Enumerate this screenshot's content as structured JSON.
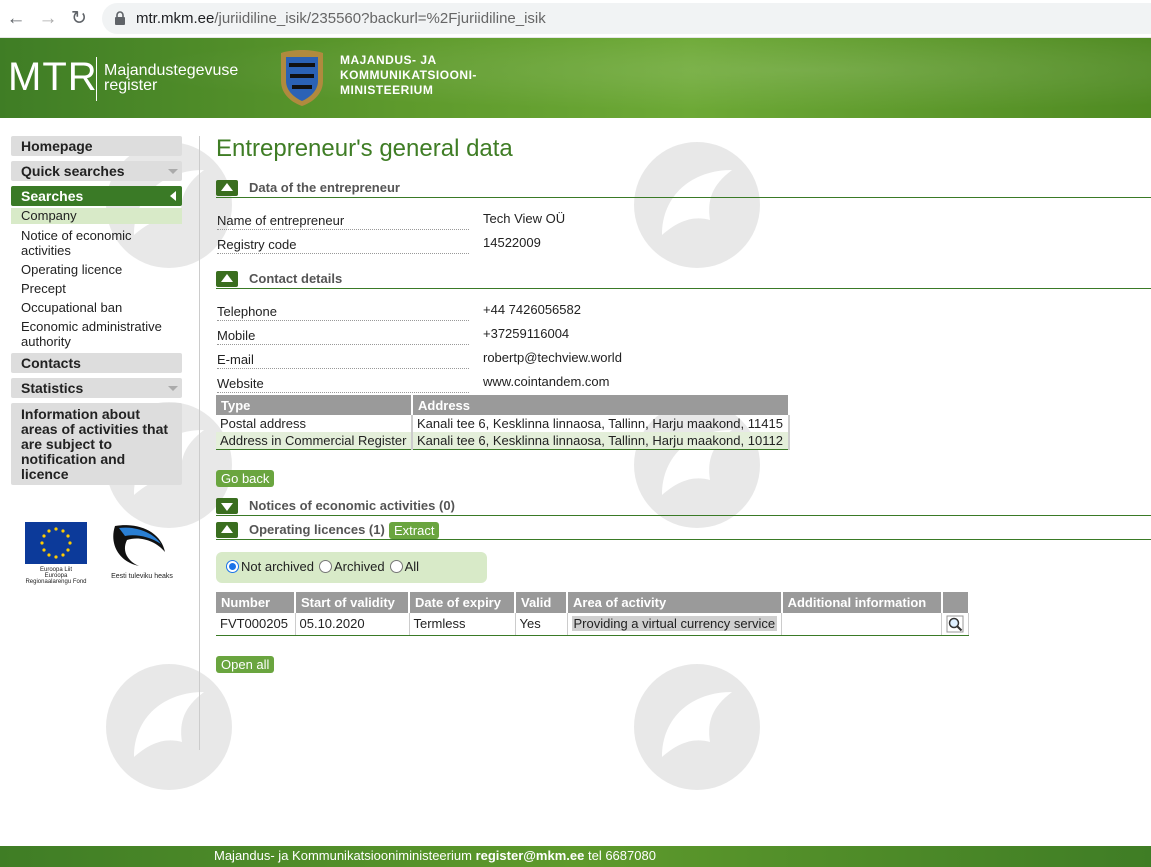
{
  "browser": {
    "url_host": "mtr.mkm.ee",
    "url_path": "/juriidiline_isik/235560?backurl=%2Fjuriidiline_isik"
  },
  "header": {
    "logo": "MTR",
    "logo_sub_line1": "Majandustegevuse",
    "logo_sub_line2": "register",
    "ministry_line1": "MAJANDUS- JA",
    "ministry_line2": "KOMMUNIKATSIOONI-",
    "ministry_line3": "MINISTEERIUM"
  },
  "sidebar": {
    "homepage": "Homepage",
    "quick_searches": "Quick searches",
    "searches": "Searches",
    "search_items": [
      "Company",
      "Notice of economic activities",
      "Operating licence",
      "Precept",
      "Occupational ban",
      "Economic administrative authority"
    ],
    "contacts": "Contacts",
    "statistics": "Statistics",
    "info": "Information about areas of activities that are subject to notification and licence",
    "eu_caption_1": "Euroopa Liit",
    "eu_caption_2": "Euroopa",
    "eu_caption_3": "Regionaalarengu Fond",
    "est_caption": "Eesti tuleviku heaks"
  },
  "main": {
    "title": "Entrepreneur's general data",
    "section_entrepreneur": "Data of the entrepreneur",
    "name_label": "Name of entrepreneur",
    "name_value": "Tech View OÜ",
    "reg_label": "Registry code",
    "reg_value": "14522009",
    "section_contact": "Contact details",
    "phone_label": "Telephone",
    "phone_value": "+44 7426056582",
    "mobile_label": "Mobile",
    "mobile_value": "+37259116004",
    "email_label": "E-mail",
    "email_value": "robertp@techview.world",
    "website_label": "Website",
    "website_value": "www.cointandem.com",
    "address_headers": [
      "Type",
      "Address"
    ],
    "addresses": [
      [
        "Postal address",
        "Kanali tee 6, Kesklinna linnaosa, Tallinn, Harju maakond, 11415"
      ],
      [
        "Address in Commercial Register",
        "Kanali tee 6, Kesklinna linnaosa, Tallinn, Harju maakond, 10112"
      ]
    ],
    "go_back": "Go back",
    "section_notices": "Notices of economic activities (0)",
    "section_licences": "Operating licences (1)",
    "extract": "Extract",
    "radio_not_archived": "Not archived",
    "radio_archived": "Archived",
    "radio_all": "All",
    "licence_headers": [
      "Number",
      "Start of validity",
      "Date of expiry",
      "Valid",
      "Area of activity",
      "Additional information"
    ],
    "licences": [
      [
        "FVT000205",
        "05.10.2020",
        "Termless",
        "Yes",
        "Providing a virtual currency service",
        ""
      ]
    ],
    "open_all": "Open all"
  },
  "footer": {
    "ministry": "Majandus- ja Kommunikatsiooniministeerium",
    "email": "register@mkm.ee",
    "phone": "tel 6687080"
  },
  "colors": {
    "brand_green": "#3f7d25",
    "button_green": "#6aa53f",
    "table_header": "#9a9a9a"
  }
}
